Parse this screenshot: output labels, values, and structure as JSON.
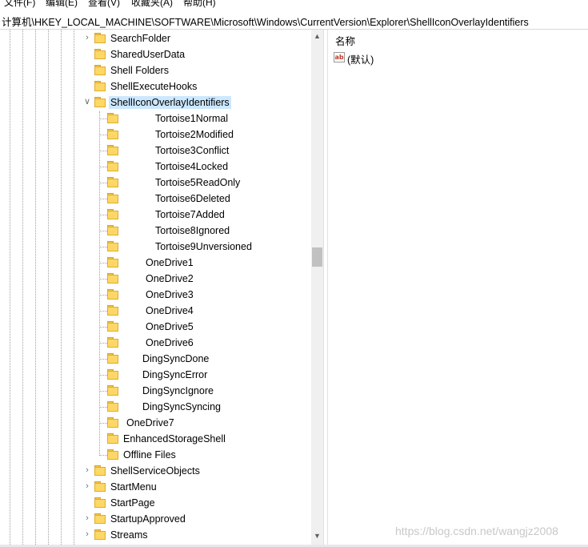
{
  "menubar": {
    "items": [
      "文件(F)",
      "编辑(E)",
      "查看(V)",
      "收藏夹(A)",
      "帮助(H)"
    ]
  },
  "address": "计算机\\HKEY_LOCAL_MACHINE\\SOFTWARE\\Microsoft\\Windows\\CurrentVersion\\Explorer\\ShellIconOverlayIdentifiers",
  "tree": {
    "items": [
      {
        "label": "SearchFolder",
        "expander": "collapsed"
      },
      {
        "label": "SharedUserData",
        "expander": "none"
      },
      {
        "label": "Shell Folders",
        "expander": "none"
      },
      {
        "label": "ShellExecuteHooks",
        "expander": "none"
      },
      {
        "label": "ShellIconOverlayIdentifiers",
        "expander": "expanded",
        "selected": true
      },
      {
        "label": "Tortoise1Normal"
      },
      {
        "label": "Tortoise2Modified"
      },
      {
        "label": "Tortoise3Conflict"
      },
      {
        "label": "Tortoise4Locked"
      },
      {
        "label": "Tortoise5ReadOnly"
      },
      {
        "label": "Tortoise6Deleted"
      },
      {
        "label": "Tortoise7Added"
      },
      {
        "label": "Tortoise8Ignored"
      },
      {
        "label": "Tortoise9Unversioned"
      },
      {
        "label": "OneDrive1"
      },
      {
        "label": "OneDrive2"
      },
      {
        "label": "OneDrive3"
      },
      {
        "label": "OneDrive4"
      },
      {
        "label": "OneDrive5"
      },
      {
        "label": "OneDrive6"
      },
      {
        "label": "DingSyncDone"
      },
      {
        "label": "DingSyncError"
      },
      {
        "label": "DingSyncIgnore"
      },
      {
        "label": "DingSyncSyncing"
      },
      {
        "label": "OneDrive7"
      },
      {
        "label": "EnhancedStorageShell"
      },
      {
        "label": "Offline Files"
      },
      {
        "label": "ShellServiceObjects",
        "expander": "collapsed"
      },
      {
        "label": "StartMenu",
        "expander": "collapsed"
      },
      {
        "label": "StartPage",
        "expander": "none"
      },
      {
        "label": "StartupApproved",
        "expander": "collapsed"
      },
      {
        "label": "Streams",
        "expander": "collapsed"
      }
    ]
  },
  "values_pane": {
    "column_name": "名称",
    "rows": [
      {
        "icon": "string-value-icon",
        "icon_text": "ab",
        "name": "(默认)"
      }
    ]
  },
  "watermark": "https://blog.csdn.net/wangjz2008",
  "colors": {
    "selection": "#cce8ff",
    "folder": "#ffd766"
  }
}
